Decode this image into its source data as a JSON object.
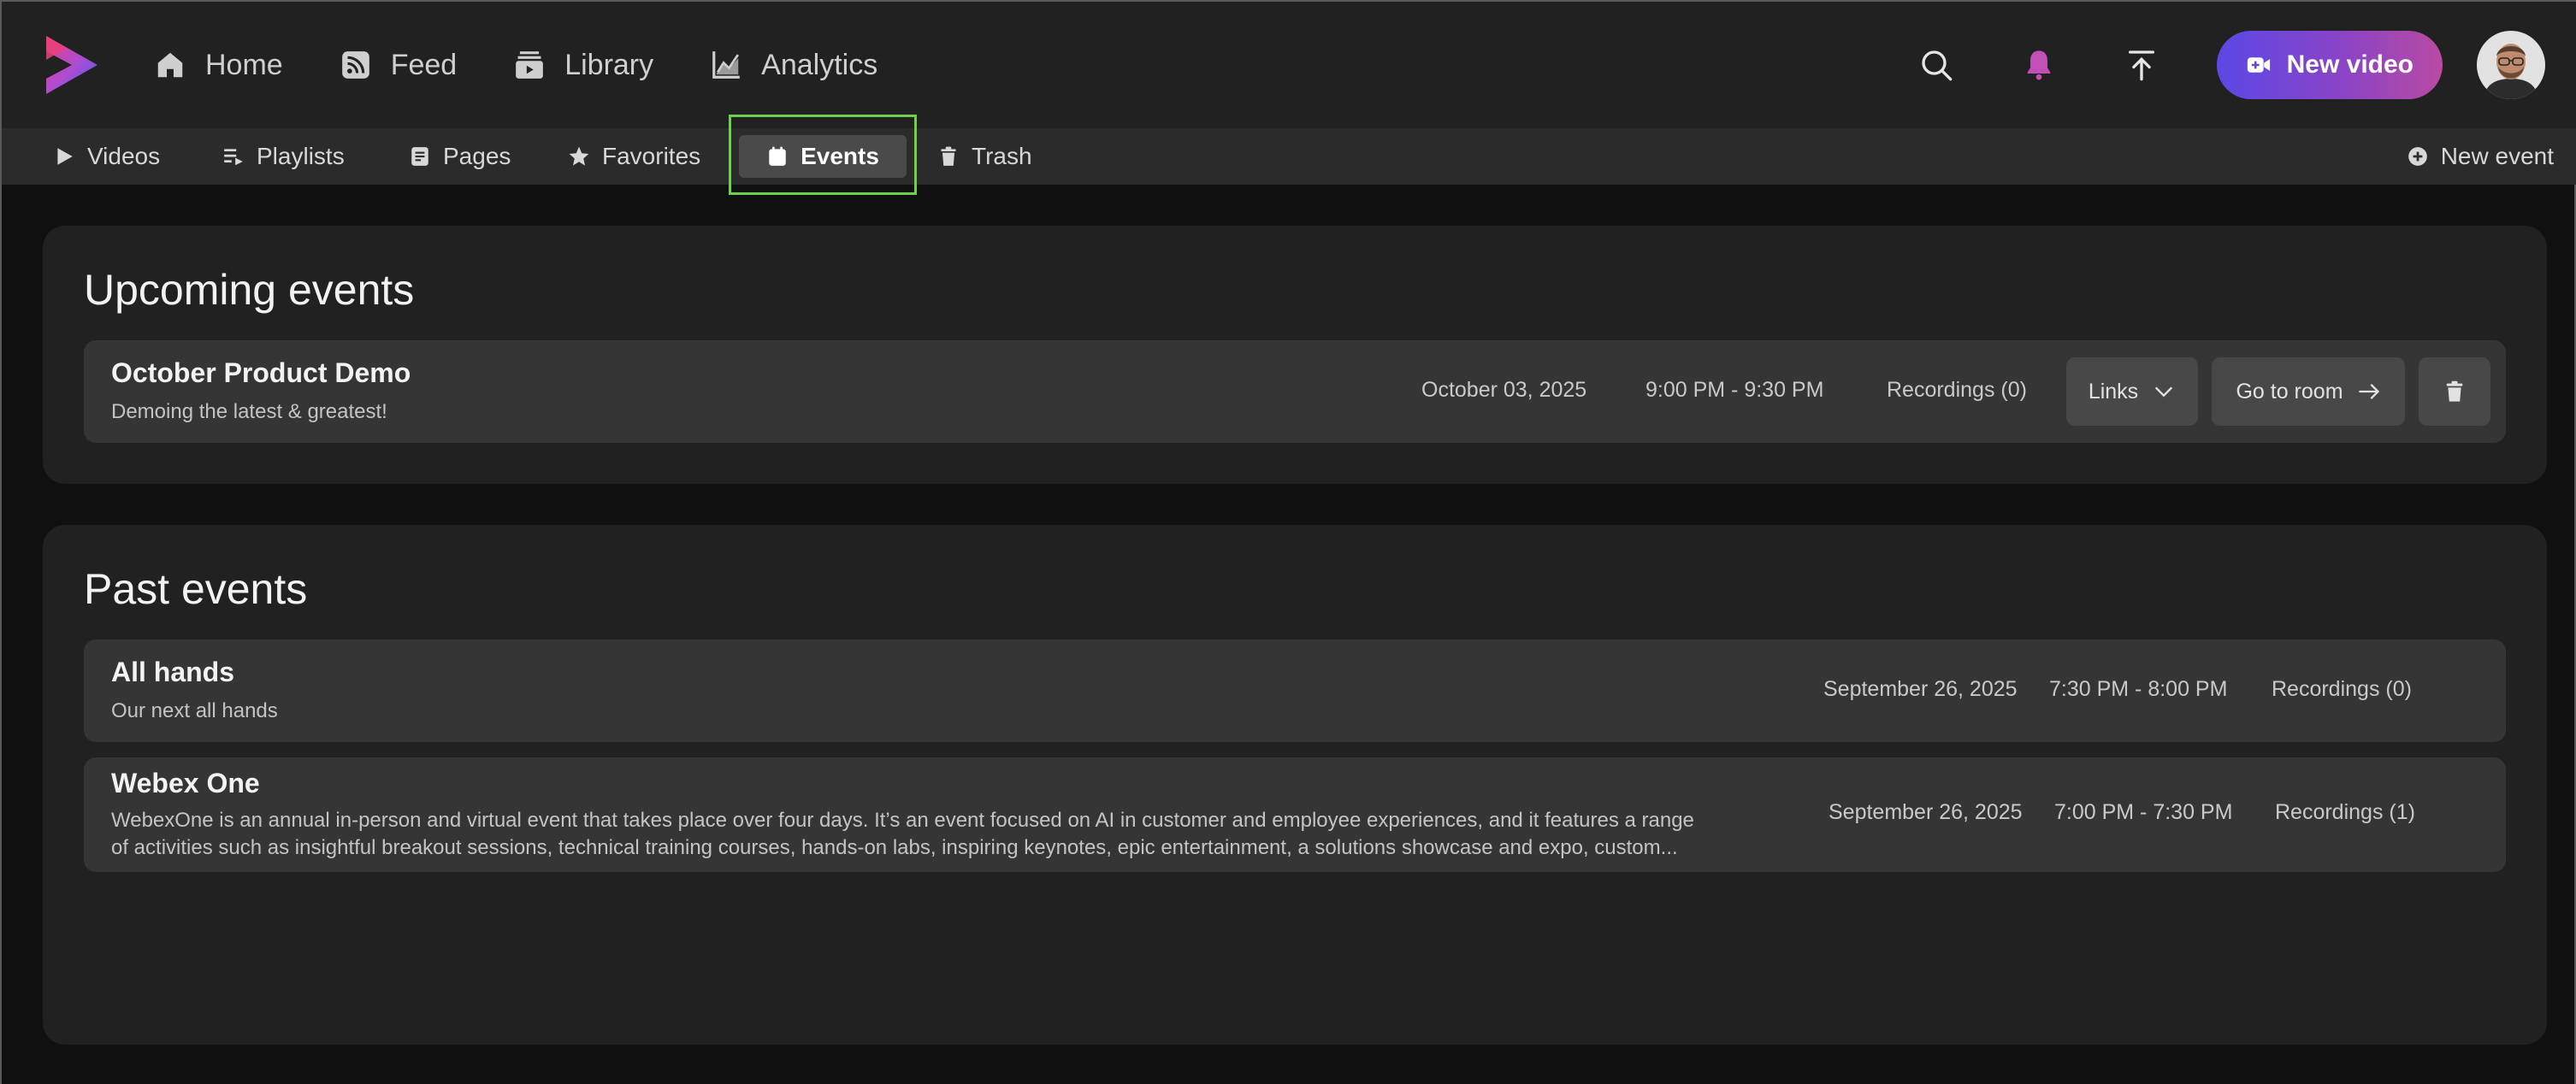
{
  "nav": {
    "items": [
      {
        "label": "Home",
        "icon": "home-icon"
      },
      {
        "label": "Feed",
        "icon": "rss-icon"
      },
      {
        "label": "Library",
        "icon": "library-icon"
      },
      {
        "label": "Analytics",
        "icon": "chart-icon"
      }
    ]
  },
  "topbar": {
    "new_video_label": "New video"
  },
  "subnav": {
    "items": [
      {
        "label": "Videos",
        "icon": "play-icon"
      },
      {
        "label": "Playlists",
        "icon": "playlist-icon"
      },
      {
        "label": "Pages",
        "icon": "page-icon"
      },
      {
        "label": "Favorites",
        "icon": "star-icon"
      },
      {
        "label": "Events",
        "icon": "calendar-icon",
        "active": true
      },
      {
        "label": "Trash",
        "icon": "trash-icon"
      }
    ],
    "new_event_label": "New event"
  },
  "upcoming": {
    "title": "Upcoming events",
    "events": [
      {
        "name": "October Product Demo",
        "description": "Demoing the latest & greatest!",
        "date": "October 03, 2025",
        "time": "9:00 PM - 9:30 PM",
        "recordings": "Recordings (0)",
        "links_label": "Links",
        "room_label": "Go to room"
      }
    ]
  },
  "past": {
    "title": "Past events",
    "events": [
      {
        "name": "All hands",
        "description": "Our next all hands",
        "date": "September 26, 2025",
        "time": "7:30 PM - 8:00 PM",
        "recordings": "Recordings (0)"
      },
      {
        "name": "Webex One",
        "description_line1": "WebexOne is an annual in-person and virtual event that takes place over four days. It’s an event focused on AI in customer and employee experiences, and it features a range",
        "description_line2": "of activities such as insightful breakout sessions, technical training courses, hands-on labs, inspiring keynotes, epic entertainment, a solutions showcase and expo, custom...",
        "date": "September 26, 2025",
        "time": "7:00 PM - 7:30 PM",
        "recordings": "Recordings (1)"
      }
    ]
  },
  "colors": {
    "accent_start": "#5b48e6",
    "accent_end": "#b84aa3",
    "bell": "#c04fb8",
    "highlight": "#6ed14a"
  }
}
